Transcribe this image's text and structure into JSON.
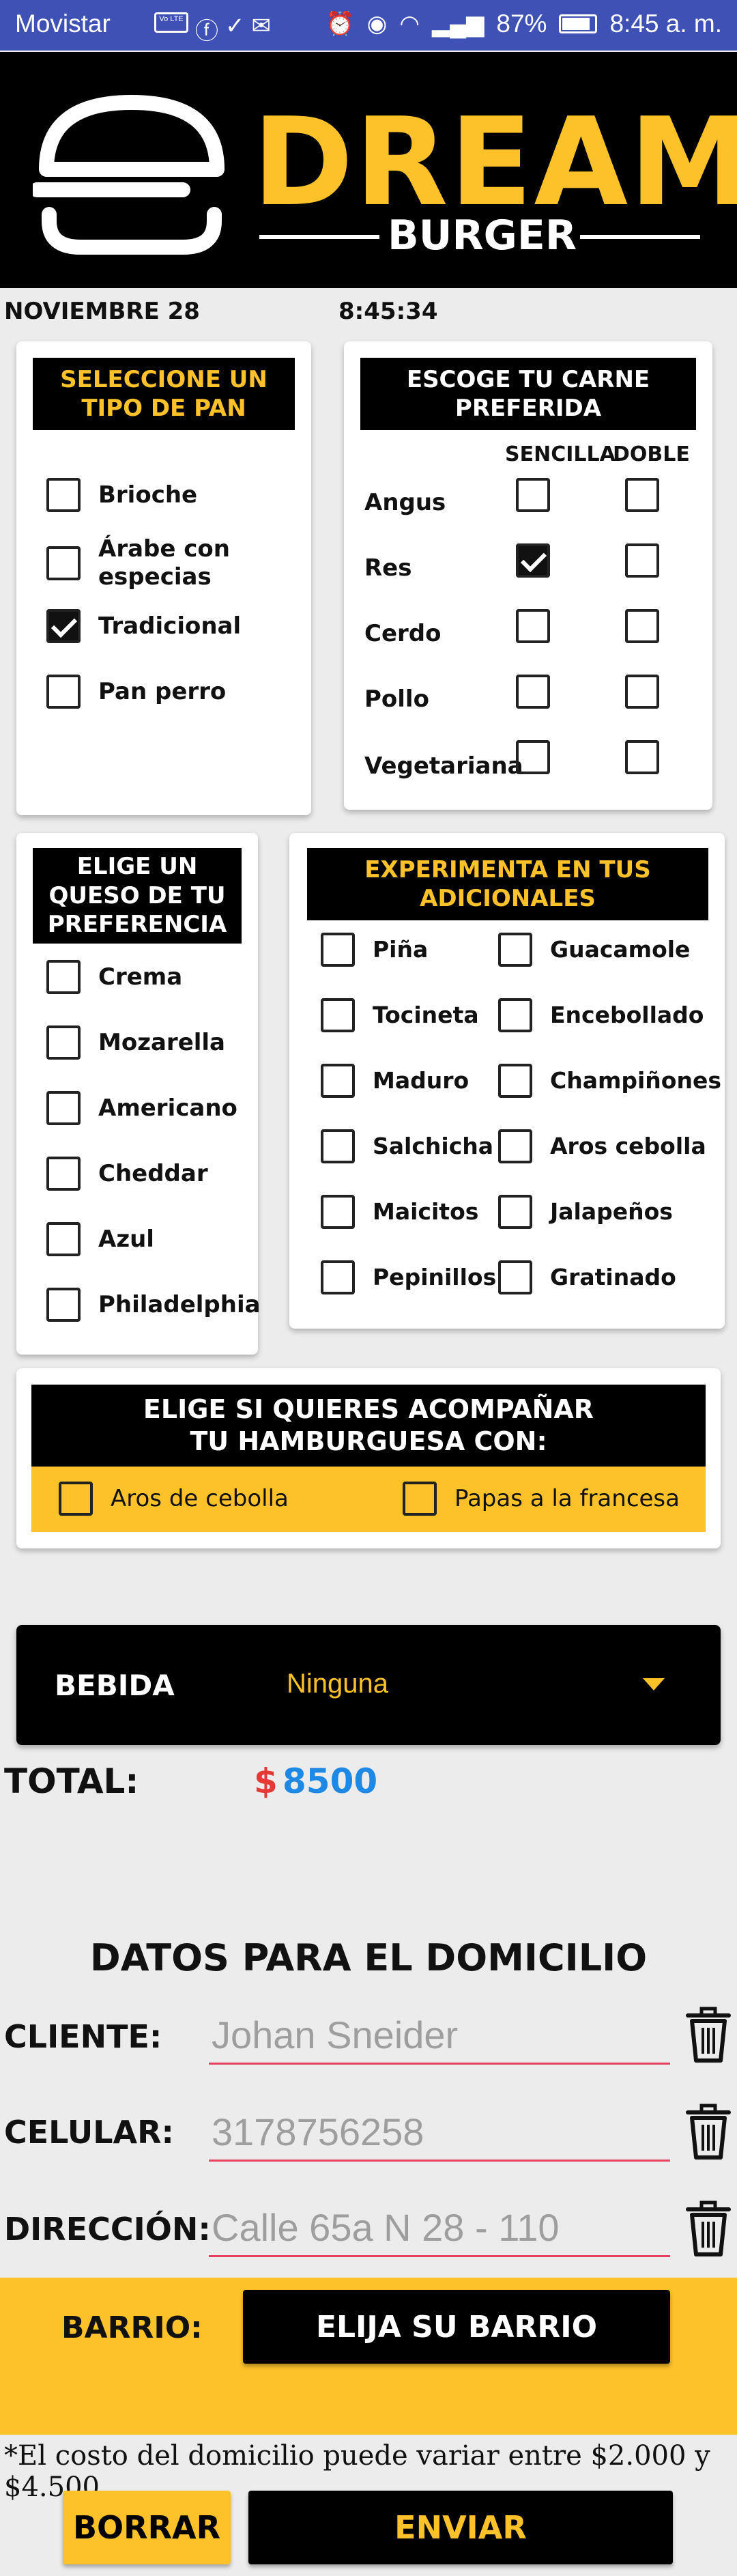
{
  "status_bar": {
    "carrier": "Movistar",
    "volte": "Vo LTE",
    "battery": "87%",
    "time": "8:45 a. m."
  },
  "brand": {
    "title": "DREAM",
    "subtitle": "BURGER",
    "accent": "#fdc22a"
  },
  "date": "NOVIEMBRE 28",
  "time": "8:45:34",
  "bread": {
    "title": "SELECCIONE UN TIPO DE PAN",
    "options": [
      {
        "label": "Brioche",
        "checked": false
      },
      {
        "label": "Árabe con especias",
        "checked": false
      },
      {
        "label": "Tradicional",
        "checked": true
      },
      {
        "label": "Pan perro",
        "checked": false
      }
    ]
  },
  "meat": {
    "title": "ESCOGE TU CARNE PREFERIDA",
    "col_single": "SENCILLA",
    "col_double": "DOBLE",
    "rows": [
      {
        "label": "Angus",
        "single": false,
        "double": false
      },
      {
        "label": "Res",
        "single": true,
        "double": false
      },
      {
        "label": "Cerdo",
        "single": false,
        "double": false
      },
      {
        "label": "Pollo",
        "single": false,
        "double": false
      },
      {
        "label": "Vegetariana",
        "single": false,
        "double": false
      }
    ]
  },
  "cheese": {
    "title": "ELIGE UN QUESO DE TU PREFERENCIA",
    "options": [
      {
        "label": "Crema",
        "checked": false
      },
      {
        "label": "Mozarella",
        "checked": false
      },
      {
        "label": "Americano",
        "checked": false
      },
      {
        "label": "Cheddar",
        "checked": false
      },
      {
        "label": "Azul",
        "checked": false
      },
      {
        "label": "Philadelphia",
        "checked": false
      }
    ]
  },
  "extras": {
    "title": "EXPERIMENTA EN TUS ADICIONALES",
    "left": [
      {
        "label": "Piña",
        "checked": false
      },
      {
        "label": "Tocineta",
        "checked": false
      },
      {
        "label": "Maduro",
        "checked": false
      },
      {
        "label": "Salchicha",
        "checked": false
      },
      {
        "label": "Maicitos",
        "checked": false
      },
      {
        "label": "Pepinillos",
        "checked": false
      }
    ],
    "right": [
      {
        "label": "Guacamole",
        "checked": false
      },
      {
        "label": "Encebollado",
        "checked": false
      },
      {
        "label": "Champiñones",
        "checked": false
      },
      {
        "label": "Aros cebolla",
        "checked": false
      },
      {
        "label": "Jalapeños",
        "checked": false
      },
      {
        "label": "Gratinado",
        "checked": false
      }
    ]
  },
  "sides": {
    "title": "ELIGE SI QUIERES ACOMPAÑAR TU HAMBURGUESA CON:",
    "options": [
      {
        "label": "Aros de cebolla",
        "checked": false
      },
      {
        "label": "Papas a la francesa",
        "checked": false
      }
    ]
  },
  "drink": {
    "label": "BEBIDA",
    "selected": "Ninguna"
  },
  "total": {
    "label": "TOTAL:",
    "currency": "$",
    "value": "8500"
  },
  "delivery": {
    "title": "DATOS  PARA EL DOMICILIO",
    "client_label": "CLIENTE:",
    "client_placeholder": "Johan Sneider",
    "phone_label": "CELULAR:",
    "phone_placeholder": "3178756258",
    "address_label": "DIRECCIÓN:",
    "address_placeholder": "Calle 65a N 28 - 110",
    "neighborhood_label": "BARRIO:",
    "neighborhood_button": "ELIJA SU BARRIO",
    "note": "*El costo del domicilio puede variar entre $2.000 y $4.500."
  },
  "actions": {
    "clear": "BORRAR",
    "send": "ENVIAR"
  }
}
